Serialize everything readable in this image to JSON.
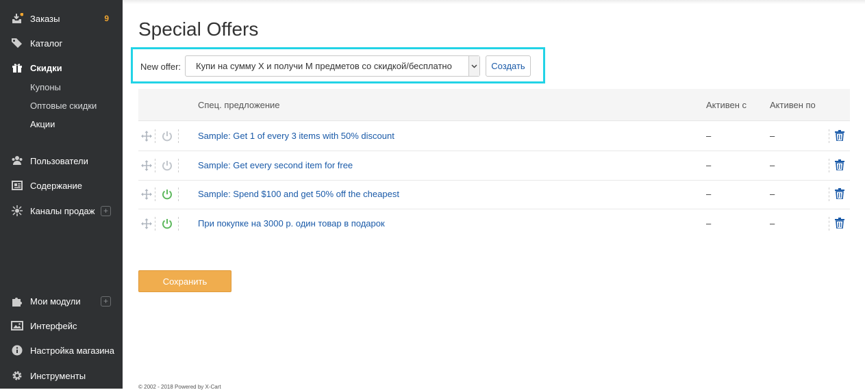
{
  "sidebar": {
    "items": [
      {
        "label": "Заказы",
        "icon": "orders-icon",
        "badge": "9"
      },
      {
        "label": "Каталог",
        "icon": "tag-icon"
      },
      {
        "label": "Скидки",
        "icon": "gift-icon"
      },
      {
        "label": "Пользователи",
        "icon": "users-icon"
      },
      {
        "label": "Содержание",
        "icon": "content-icon"
      },
      {
        "label": "Каналы продаж",
        "icon": "sales-channels-icon"
      },
      {
        "label": "Мои модули",
        "icon": "puzzle-icon"
      },
      {
        "label": "Интерфейс",
        "icon": "image-icon"
      },
      {
        "label": "Настройка магазина",
        "icon": "info-icon"
      },
      {
        "label": "Инструменты",
        "icon": "gear-icon"
      }
    ],
    "subitems": [
      "Купоны",
      "Оптовые скидки",
      "Акции"
    ],
    "colors": {
      "background": "#2f3133",
      "badge": "#f0a530"
    }
  },
  "page": {
    "title": "Special Offers",
    "new_offer_label": "New offer:",
    "new_offer_select_value": "Купи на сумму Х и получи М предметов со скидкой/бесплатно",
    "create_button": "Создать",
    "save_button": "Сохранить",
    "footer": "© 2002 - 2018 Powered by X-Cart",
    "highlight_color": "#22d3e6"
  },
  "table": {
    "headers": {
      "name": "Спец. предложение",
      "from": "Активен с",
      "to": "Активен по"
    },
    "rows": [
      {
        "name": "Sample: Get 1 of every 3 items with 50% discount",
        "from": "–",
        "to": "–",
        "enabled": false
      },
      {
        "name": "Sample: Get every second item for free",
        "from": "–",
        "to": "–",
        "enabled": false
      },
      {
        "name": "Sample: Spend $100 and get 50% off the cheapest",
        "from": "–",
        "to": "–",
        "enabled": true
      },
      {
        "name": "При покупке на 3000 р. один товар в подарок",
        "from": "–",
        "to": "–",
        "enabled": true
      }
    ]
  }
}
